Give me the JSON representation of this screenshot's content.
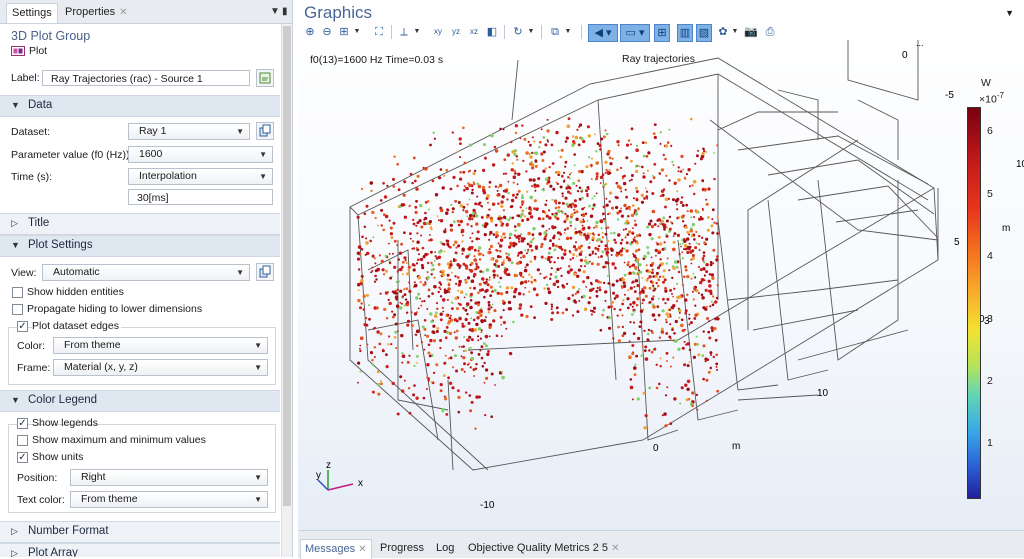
{
  "settings_panel": {
    "tabs": [
      "Settings",
      "Properties"
    ],
    "group_title": "3D Plot Group",
    "plot_button_label": "Plot",
    "label": {
      "caption": "Label:",
      "value": "Ray Trajectories (rac) - Source 1"
    },
    "data_section": {
      "title": "Data",
      "dataset_caption": "Dataset:",
      "dataset_value": "Ray 1",
      "parameter_caption": "Parameter value (f0 (Hz)):",
      "parameter_value": "1600",
      "time_caption": "Time (s):",
      "time_value": "Interpolation",
      "time_input": "30[ms]"
    },
    "title_section": "Title",
    "plot_settings": {
      "title": "Plot Settings",
      "view_caption": "View:",
      "view_value": "Automatic",
      "show_hidden": "Show hidden entities",
      "propagate_hiding": "Propagate hiding to lower dimensions",
      "plot_dataset_edges": "Plot dataset edges",
      "color_caption": "Color:",
      "color_value": "From theme",
      "frame_caption": "Frame:",
      "frame_value": "Material  (x, y, z)"
    },
    "color_legend": {
      "title": "Color Legend",
      "show_legends": "Show legends",
      "show_maxmin": "Show maximum and minimum values",
      "show_units": "Show units",
      "position_caption": "Position:",
      "position_value": "Right",
      "text_color_caption": "Text color:",
      "text_color_value": "From theme"
    },
    "number_format": "Number Format",
    "next_section_partial": "Plot Array"
  },
  "graphics": {
    "title": "Graphics",
    "info_text": "f0(13)=1600 Hz Time=0.03 s",
    "plot_title": "Ray trajectories",
    "colorbar": {
      "unit": "W",
      "exponent": "×10",
      "exponent_power": "-7",
      "ticks": [
        "6",
        "5",
        "4",
        "3",
        "2",
        "1"
      ]
    },
    "axis_labels": [
      "0",
      "...",
      "-5",
      "10",
      "5",
      "m",
      "0",
      "3",
      "10",
      "0",
      "m",
      "-10"
    ],
    "triad": {
      "x": "x",
      "y": "y",
      "z": "z"
    }
  },
  "bottom_tabs": [
    "Messages",
    "Progress",
    "Log",
    "Objective Quality Metrics 2 5"
  ],
  "colors": {
    "accent": "#4a6595",
    "section_bg": "#dfe7f1",
    "ray_red": "#c4161b"
  }
}
